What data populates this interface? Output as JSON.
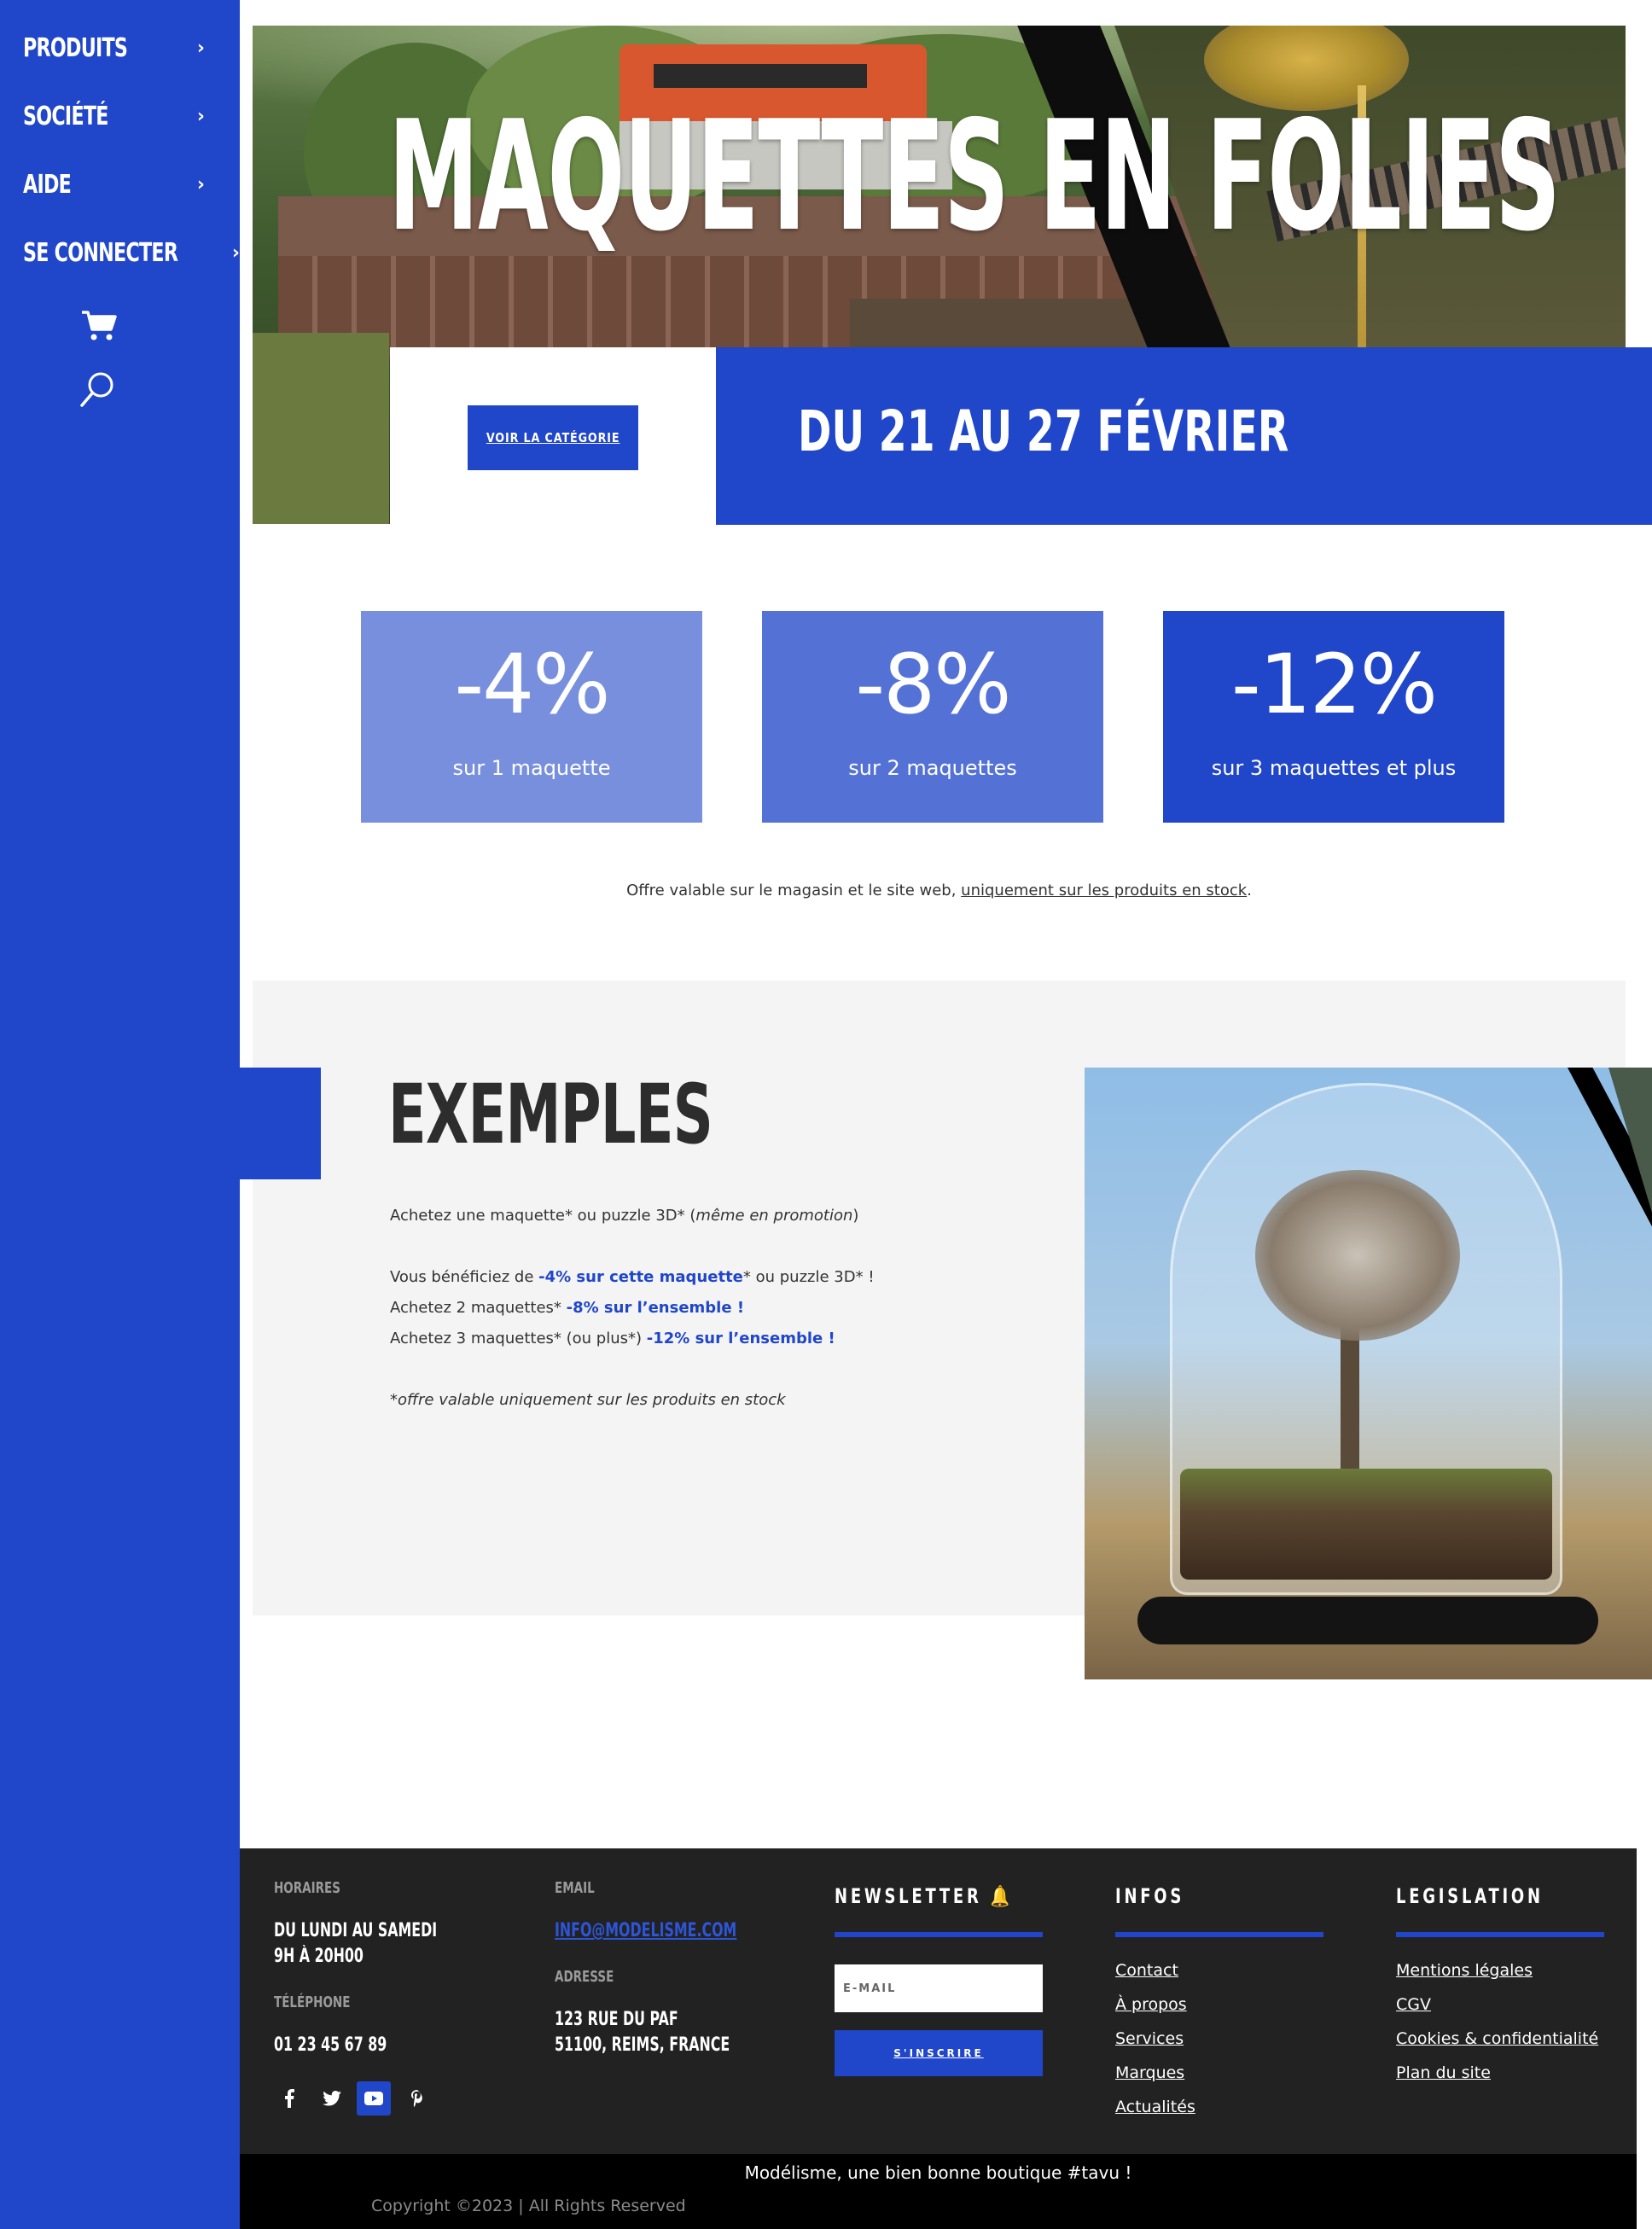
{
  "sidebar": {
    "items": [
      {
        "label": "PRODUITS"
      },
      {
        "label": "SOCIÉTÉ"
      },
      {
        "label": "AIDE"
      },
      {
        "label": "SE CONNECTER"
      }
    ],
    "cart_icon": "cart-icon",
    "search_icon": "search-icon"
  },
  "hero": {
    "title": "MAQUETTES EN FOLIES",
    "button_label": "VOIR LA CATÉGORIE",
    "dates": "DU 21 AU 27 FÉVRIER"
  },
  "discounts": [
    {
      "value": "-4%",
      "label": "sur 1 maquette",
      "color": "#788fde"
    },
    {
      "value": "-8%",
      "label": "sur 2 maquettes",
      "color": "#5472d6"
    },
    {
      "value": "-12%",
      "label": "sur 3 maquettes et plus",
      "color": "#2046c9"
    }
  ],
  "offer": {
    "text": "Offre valable sur le magasin et le site web, ",
    "link": "uniquement sur les produits en stock",
    "end": "."
  },
  "exemples": {
    "title": "EXEMPLES",
    "line1_a": "Achetez une maquette* ou puzzle 3D* (",
    "line1_em": "même en promotion",
    "line1_b": ")",
    "line2_a": "Vous bénéficiez de ",
    "line2_b": "-4% sur cette maquette",
    "line2_c": "* ou puzzle 3D* !",
    "line3_a": "Achetez 2 maquettes* ",
    "line3_b": "-8% sur l’ensemble !",
    "line4_a": "Achetez 3 maquettes* (ou plus*) ",
    "line4_b": "-12% sur l’ensemble !",
    "note": "*offre valable uniquement sur les produits en stock"
  },
  "footer": {
    "horaires_label": "HORAIRES",
    "horaires_line1": "DU LUNDI AU SAMEDI",
    "horaires_line2": "9H À 20H00",
    "telephone_label": "TÉLÉPHONE",
    "telephone": "01 23 45 67 89",
    "email_label": "EMAIL",
    "email": "INFO@MODELISME.COM",
    "adresse_label": "ADRESSE",
    "adresse_line1": "123 RUE DU PAF",
    "adresse_line2": "51100, REIMS, FRANCE",
    "newsletter_heading": "NEWSLETTER 🔔",
    "newsletter_placeholder": "E-MAIL",
    "newsletter_button": "S'INSCRIRE",
    "infos_heading": "INFOS",
    "infos_links": [
      "Contact",
      "À propos",
      "Services",
      "Marques",
      "Actualités"
    ],
    "legislation_heading": "LEGISLATION",
    "legislation_links": [
      "Mentions légales",
      "CGV",
      "Cookies & confidentialité",
      "Plan du site"
    ],
    "social_icons": [
      "facebook-icon",
      "twitter-icon",
      "youtube-icon",
      "pinterest-icon"
    ],
    "tagline": "Modélisme, une bien bonne boutique #tavu !",
    "copyright": "Copyright ©2023 | All Rights Reserved"
  }
}
